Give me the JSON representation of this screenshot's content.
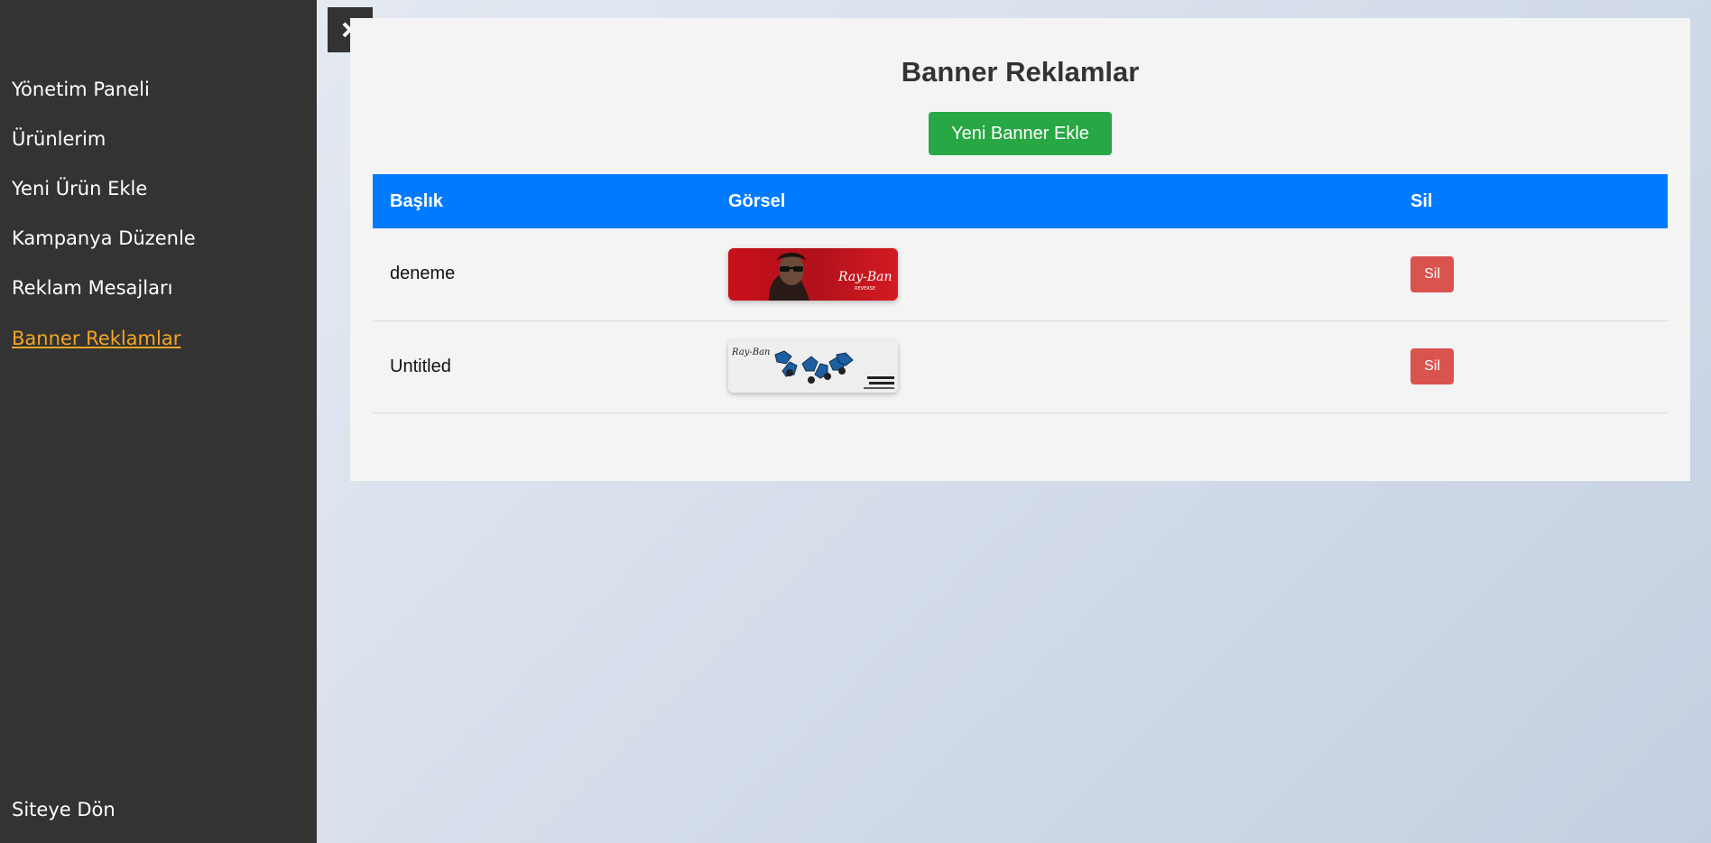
{
  "sidebar": {
    "items": [
      {
        "label": "Yönetim Paneli"
      },
      {
        "label": "Ürünlerim"
      },
      {
        "label": "Yeni Ürün Ekle"
      },
      {
        "label": "Kampanya Düzenle"
      },
      {
        "label": "Reklam Mesajları"
      },
      {
        "label": "Banner Reklamlar",
        "active": true
      }
    ],
    "footer_label": "Siteye Dön"
  },
  "close_icon": "close-icon",
  "main": {
    "title": "Banner Reklamlar",
    "add_button_label": "Yeni Banner Ekle",
    "table": {
      "headers": [
        "Başlık",
        "Görsel",
        "Sil"
      ],
      "rows": [
        {
          "title": "deneme",
          "image": "banner-image-red-sunglasses",
          "delete_label": "Sil"
        },
        {
          "title": "Untitled",
          "image": "banner-image-sunglasses-collection",
          "delete_label": "Sil"
        }
      ]
    }
  },
  "colors": {
    "sidebar_bg": "#333333",
    "active_link": "#f5a623",
    "header_blue": "#007bff",
    "add_green": "#28a745",
    "delete_red": "#d9534f"
  }
}
